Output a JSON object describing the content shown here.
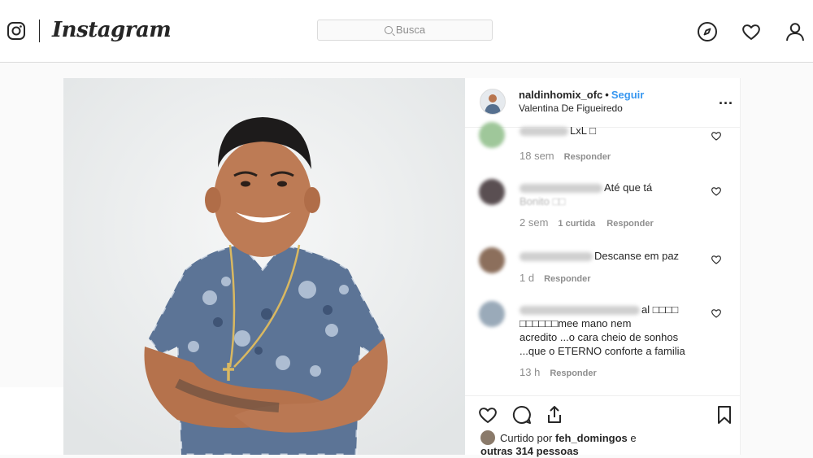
{
  "header": {
    "brand": "Instagram",
    "search_placeholder": "Busca"
  },
  "post": {
    "username": "naldinhomix_ofc",
    "follow_label": "Seguir",
    "location": "Valentina De Figueiredo",
    "more_label": "..."
  },
  "comments": [
    {
      "text_visible": "LxL □",
      "age": "18 sem",
      "likes": "",
      "reply": "Responder",
      "avatar_color": "#9fc79a"
    },
    {
      "text_visible": "Até que tá",
      "text_line2": "Bonito □□",
      "age": "2 sem",
      "likes": "1 curtida",
      "reply": "Responder",
      "avatar_color": "#5a4f52"
    },
    {
      "text_visible": "Descanse em paz",
      "age": "1 d",
      "likes": "",
      "reply": "Responder",
      "avatar_color": "#8c6f5c"
    },
    {
      "text_visible": "al □□□□",
      "text_line2": "□□□□□□mee mano nem",
      "text_line3": "acredito ...o cara cheio de sonhos",
      "text_line4": "...que o ETERNO conforte a familia",
      "age": "13 h",
      "likes": "",
      "reply": "Responder",
      "avatar_color": "#9aaab9"
    }
  ],
  "footer": {
    "liked_prefix": "Curtido por",
    "liked_user": "feh_domingos",
    "liked_conj": "e",
    "liked_others": "outras 314 pessoas"
  }
}
